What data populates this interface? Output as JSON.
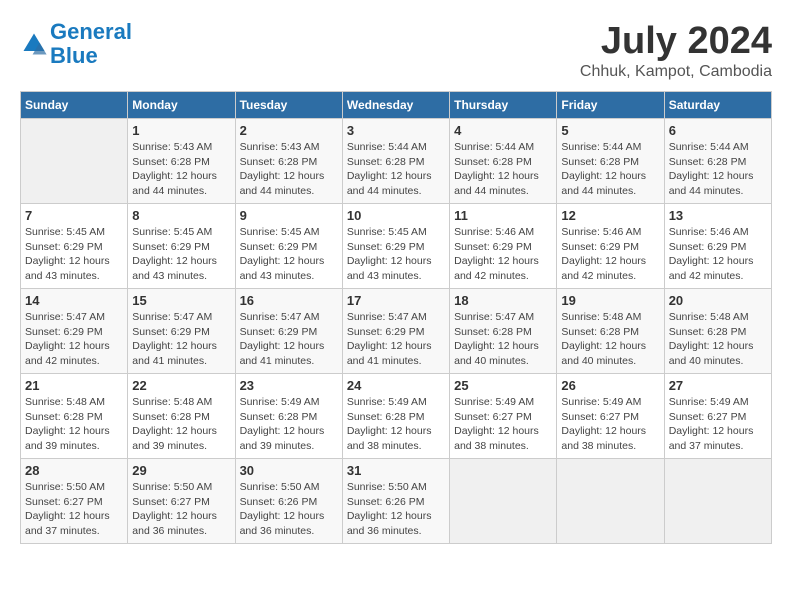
{
  "header": {
    "logo_line1": "General",
    "logo_line2": "Blue",
    "month_year": "July 2024",
    "location": "Chhuk, Kampot, Cambodia"
  },
  "days_of_week": [
    "Sunday",
    "Monday",
    "Tuesday",
    "Wednesday",
    "Thursday",
    "Friday",
    "Saturday"
  ],
  "weeks": [
    [
      {
        "day": "",
        "info": ""
      },
      {
        "day": "1",
        "info": "Sunrise: 5:43 AM\nSunset: 6:28 PM\nDaylight: 12 hours\nand 44 minutes."
      },
      {
        "day": "2",
        "info": "Sunrise: 5:43 AM\nSunset: 6:28 PM\nDaylight: 12 hours\nand 44 minutes."
      },
      {
        "day": "3",
        "info": "Sunrise: 5:44 AM\nSunset: 6:28 PM\nDaylight: 12 hours\nand 44 minutes."
      },
      {
        "day": "4",
        "info": "Sunrise: 5:44 AM\nSunset: 6:28 PM\nDaylight: 12 hours\nand 44 minutes."
      },
      {
        "day": "5",
        "info": "Sunrise: 5:44 AM\nSunset: 6:28 PM\nDaylight: 12 hours\nand 44 minutes."
      },
      {
        "day": "6",
        "info": "Sunrise: 5:44 AM\nSunset: 6:28 PM\nDaylight: 12 hours\nand 44 minutes."
      }
    ],
    [
      {
        "day": "7",
        "info": "Sunrise: 5:45 AM\nSunset: 6:29 PM\nDaylight: 12 hours\nand 43 minutes."
      },
      {
        "day": "8",
        "info": "Sunrise: 5:45 AM\nSunset: 6:29 PM\nDaylight: 12 hours\nand 43 minutes."
      },
      {
        "day": "9",
        "info": "Sunrise: 5:45 AM\nSunset: 6:29 PM\nDaylight: 12 hours\nand 43 minutes."
      },
      {
        "day": "10",
        "info": "Sunrise: 5:45 AM\nSunset: 6:29 PM\nDaylight: 12 hours\nand 43 minutes."
      },
      {
        "day": "11",
        "info": "Sunrise: 5:46 AM\nSunset: 6:29 PM\nDaylight: 12 hours\nand 42 minutes."
      },
      {
        "day": "12",
        "info": "Sunrise: 5:46 AM\nSunset: 6:29 PM\nDaylight: 12 hours\nand 42 minutes."
      },
      {
        "day": "13",
        "info": "Sunrise: 5:46 AM\nSunset: 6:29 PM\nDaylight: 12 hours\nand 42 minutes."
      }
    ],
    [
      {
        "day": "14",
        "info": "Sunrise: 5:47 AM\nSunset: 6:29 PM\nDaylight: 12 hours\nand 42 minutes."
      },
      {
        "day": "15",
        "info": "Sunrise: 5:47 AM\nSunset: 6:29 PM\nDaylight: 12 hours\nand 41 minutes."
      },
      {
        "day": "16",
        "info": "Sunrise: 5:47 AM\nSunset: 6:29 PM\nDaylight: 12 hours\nand 41 minutes."
      },
      {
        "day": "17",
        "info": "Sunrise: 5:47 AM\nSunset: 6:29 PM\nDaylight: 12 hours\nand 41 minutes."
      },
      {
        "day": "18",
        "info": "Sunrise: 5:47 AM\nSunset: 6:28 PM\nDaylight: 12 hours\nand 40 minutes."
      },
      {
        "day": "19",
        "info": "Sunrise: 5:48 AM\nSunset: 6:28 PM\nDaylight: 12 hours\nand 40 minutes."
      },
      {
        "day": "20",
        "info": "Sunrise: 5:48 AM\nSunset: 6:28 PM\nDaylight: 12 hours\nand 40 minutes."
      }
    ],
    [
      {
        "day": "21",
        "info": "Sunrise: 5:48 AM\nSunset: 6:28 PM\nDaylight: 12 hours\nand 39 minutes."
      },
      {
        "day": "22",
        "info": "Sunrise: 5:48 AM\nSunset: 6:28 PM\nDaylight: 12 hours\nand 39 minutes."
      },
      {
        "day": "23",
        "info": "Sunrise: 5:49 AM\nSunset: 6:28 PM\nDaylight: 12 hours\nand 39 minutes."
      },
      {
        "day": "24",
        "info": "Sunrise: 5:49 AM\nSunset: 6:28 PM\nDaylight: 12 hours\nand 38 minutes."
      },
      {
        "day": "25",
        "info": "Sunrise: 5:49 AM\nSunset: 6:27 PM\nDaylight: 12 hours\nand 38 minutes."
      },
      {
        "day": "26",
        "info": "Sunrise: 5:49 AM\nSunset: 6:27 PM\nDaylight: 12 hours\nand 38 minutes."
      },
      {
        "day": "27",
        "info": "Sunrise: 5:49 AM\nSunset: 6:27 PM\nDaylight: 12 hours\nand 37 minutes."
      }
    ],
    [
      {
        "day": "28",
        "info": "Sunrise: 5:50 AM\nSunset: 6:27 PM\nDaylight: 12 hours\nand 37 minutes."
      },
      {
        "day": "29",
        "info": "Sunrise: 5:50 AM\nSunset: 6:27 PM\nDaylight: 12 hours\nand 36 minutes."
      },
      {
        "day": "30",
        "info": "Sunrise: 5:50 AM\nSunset: 6:26 PM\nDaylight: 12 hours\nand 36 minutes."
      },
      {
        "day": "31",
        "info": "Sunrise: 5:50 AM\nSunset: 6:26 PM\nDaylight: 12 hours\nand 36 minutes."
      },
      {
        "day": "",
        "info": ""
      },
      {
        "day": "",
        "info": ""
      },
      {
        "day": "",
        "info": ""
      }
    ]
  ]
}
